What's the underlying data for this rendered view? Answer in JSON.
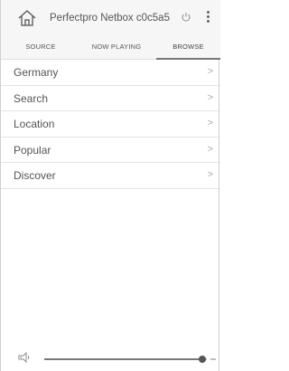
{
  "header": {
    "title": "Perfectpro Netbox c0c5a5",
    "home_icon": "home-icon",
    "power_icon": "power-icon",
    "menu_icon": "more-vertical-icon"
  },
  "tabs": [
    {
      "label": "SOURCE",
      "active": false
    },
    {
      "label": "NOW PLAYING",
      "active": false
    },
    {
      "label": "BROWSE",
      "active": true
    }
  ],
  "browse": {
    "items": [
      {
        "label": "Germany",
        "chevron": ">"
      },
      {
        "label": "Search",
        "chevron": ">"
      },
      {
        "label": "Location",
        "chevron": ">"
      },
      {
        "label": "Popular",
        "chevron": ">"
      },
      {
        "label": "Discover",
        "chevron": ">"
      }
    ]
  },
  "footer": {
    "volume_icon": "speaker-icon",
    "volume_level": 0.97
  },
  "colors": {
    "header_bg": "#f6f6f6",
    "text": "#555555",
    "divider": "#e3e3e3",
    "slider_track": "#bdbdbd",
    "slider_thumb": "#555555"
  }
}
